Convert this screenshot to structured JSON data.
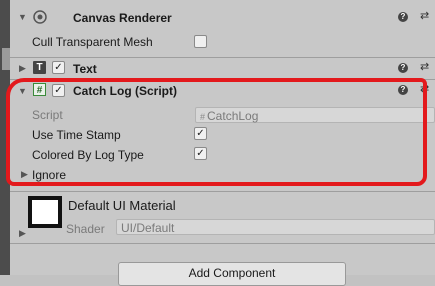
{
  "canvas_renderer": {
    "title": "Canvas Renderer",
    "cull_label": "Cull Transparent Mesh",
    "cull_checked": false
  },
  "text_component": {
    "title": "Text",
    "enabled": true
  },
  "catch_log": {
    "title": "Catch Log (Script)",
    "enabled": true,
    "script_label": "Script",
    "script_value": "CatchLog",
    "use_time_stamp_label": "Use Time Stamp",
    "use_time_stamp_checked": true,
    "colored_label": "Colored By Log Type",
    "colored_checked": true,
    "ignore_label": "Ignore"
  },
  "material": {
    "title": "Default UI Material",
    "shader_label": "Shader",
    "shader_value": "UI/Default"
  },
  "glyphs": {
    "help": "?",
    "presets": "⇄",
    "fold_down": "▼",
    "fold_right": "▶",
    "check": "✓",
    "script_hash": "#",
    "text_icon": "T"
  },
  "add_component": {
    "label": "Add Component"
  }
}
